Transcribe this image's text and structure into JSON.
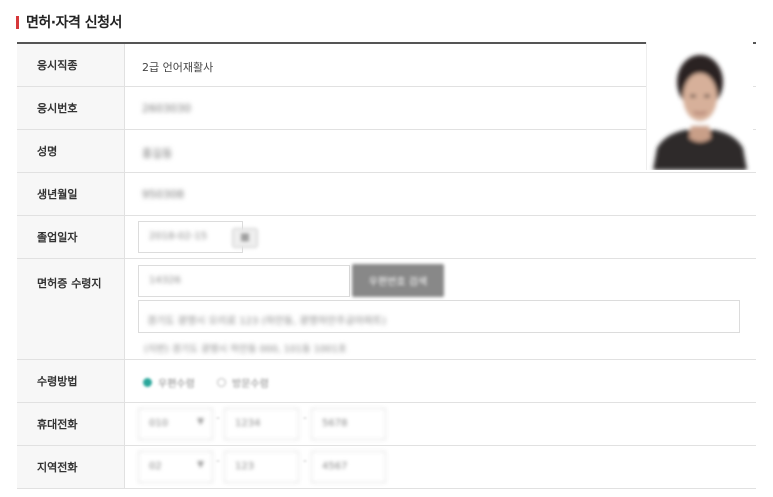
{
  "form_title": "면허·자격 신청서",
  "fields": {
    "exam_type": {
      "label": "응시직종",
      "value": "2급 언어재활사"
    },
    "exam_number": {
      "label": "응시번호",
      "value": "2603030"
    },
    "name": {
      "label": "성명",
      "value": "홍길동"
    },
    "birth_date": {
      "label": "생년월일",
      "value": "950308"
    },
    "graduation_date": {
      "label": "졸업일자",
      "value": "2018-02-15"
    },
    "license_address": {
      "label": "면허증 수령지",
      "zipcode": "14326",
      "search_button": "우편번호 검색",
      "road_address": "경기도 광명시 오리로 123 (하안동, 광명하안주공아파트)",
      "jibun_address": "(지번) 경기도 광명시 하안동 000, 101동 1001호"
    },
    "receive_method": {
      "label": "수령방법",
      "options": [
        {
          "label": "우편수령",
          "selected": true
        },
        {
          "label": "방문수령",
          "selected": false
        }
      ]
    },
    "mobile_phone": {
      "label": "휴대전화",
      "prefix": "010",
      "middle": "1234",
      "last": "5678"
    },
    "local_phone": {
      "label": "지역전화",
      "prefix": "02",
      "middle": "123",
      "last": "4567"
    }
  },
  "icons": {
    "calendar": "calendar-icon",
    "dropdown": "chevron-down-icon"
  },
  "colors": {
    "title_accent": "#d6373a",
    "radio_selected": "#2aa79b",
    "header_cell_bg": "#f7f7f7",
    "button_bg": "#888888"
  }
}
